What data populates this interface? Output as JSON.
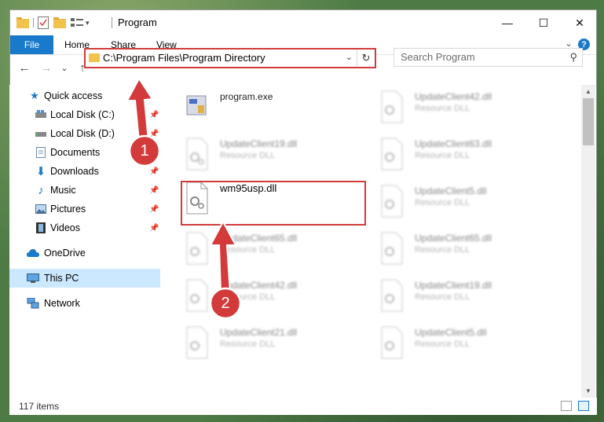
{
  "window": {
    "title": "Program",
    "controls": {
      "minimize": "—",
      "maximize": "☐",
      "close": "✕"
    }
  },
  "ribbon": {
    "tabs": [
      {
        "label": "File"
      },
      {
        "label": "Home"
      },
      {
        "label": "Share"
      },
      {
        "label": "View"
      }
    ],
    "help": "?",
    "collapse": "⌄"
  },
  "address": {
    "path": "C:\\Program Files\\Program Directory",
    "refresh": "↻",
    "dropdown": "⌄"
  },
  "search": {
    "placeholder": "Search Program"
  },
  "nav_buttons": {
    "back": "←",
    "forward": "→",
    "recent": "⌄",
    "up": "↑"
  },
  "sidebar": {
    "items": [
      {
        "label": "Quick access",
        "icon": "star-icon",
        "pinned": false
      },
      {
        "label": "Local Disk (C:)",
        "icon": "drive-icon",
        "pinned": true
      },
      {
        "label": "Local Disk (D:)",
        "icon": "drive-icon",
        "pinned": true
      },
      {
        "label": "Documents",
        "icon": "documents-icon",
        "pinned": true
      },
      {
        "label": "Downloads",
        "icon": "download-icon",
        "pinned": true
      },
      {
        "label": "Music",
        "icon": "music-icon",
        "pinned": true
      },
      {
        "label": "Pictures",
        "icon": "pictures-icon",
        "pinned": true
      },
      {
        "label": "Videos",
        "icon": "videos-icon",
        "pinned": true
      },
      {
        "label": "OneDrive",
        "icon": "cloud-icon",
        "pinned": false
      },
      {
        "label": "This PC",
        "icon": "computer-icon",
        "pinned": false,
        "selected": true
      },
      {
        "label": "Network",
        "icon": "network-icon",
        "pinned": false
      }
    ]
  },
  "files": {
    "left": [
      {
        "name": "program.exe",
        "type": ""
      },
      {
        "name": "UpdateClient19.dll",
        "type": "Resource DLL"
      },
      {
        "name": "wm95usp.dll",
        "type": ""
      },
      {
        "name": "UpdateClient65.dll",
        "type": "Resource DLL"
      },
      {
        "name": "UpdateClient42.dll",
        "type": "Resource DLL"
      },
      {
        "name": "UpdateClient21.dll",
        "type": "Resource DLL"
      }
    ],
    "right": [
      {
        "name": "UpdateClient42.dll",
        "type": "Resource DLL"
      },
      {
        "name": "UpdateClient63.dll",
        "type": "Resource DLL"
      },
      {
        "name": "UpdateClient5.dll",
        "type": "Resource DLL"
      },
      {
        "name": "UpdateClient65.dll",
        "type": "Resource DLL"
      },
      {
        "name": "UpdateClient19.dll",
        "type": "Resource DLL"
      },
      {
        "name": "UpdateClient5.dll",
        "type": "Resource DLL"
      }
    ]
  },
  "annotations": {
    "step1": "1",
    "step2": "2",
    "color": "#d33b3b"
  },
  "status": {
    "count": "117 items"
  },
  "colors": {
    "accent": "#1979ca",
    "selection": "#cce8ff",
    "highlight": "#d33b3b"
  }
}
